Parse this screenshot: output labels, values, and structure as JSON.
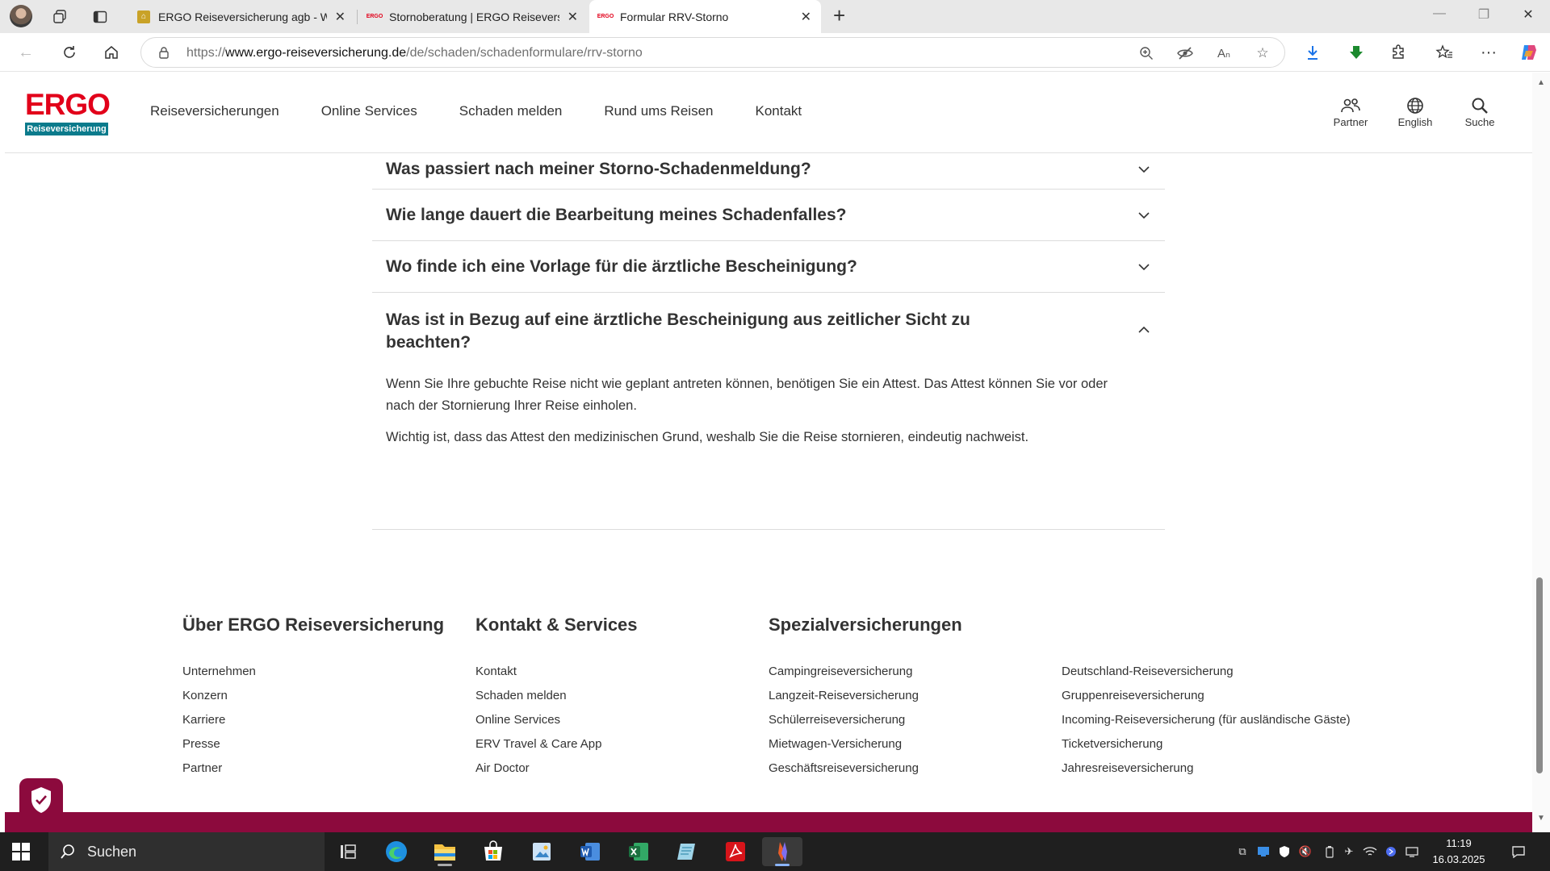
{
  "browser": {
    "tabs": [
      {
        "title": "ERGO Reiseversicherung agb - Wi",
        "favicon": "wikipedia-favicon",
        "active": false
      },
      {
        "title": "Stornoberatung | ERGO Reiseversi",
        "favicon": "ergo-favicon",
        "active": false
      },
      {
        "title": "Formular RRV-Storno",
        "favicon": "ergo-favicon",
        "active": true
      }
    ],
    "favicon_text": "ERGO",
    "url_prefix": "https://",
    "url_domain": "www.ergo-reiseversicherung.de",
    "url_path": "/de/schaden/schadenformulare/rrv-storno"
  },
  "site": {
    "logo_word": "ERGO",
    "logo_sub": "Reiseversicherung",
    "nav": [
      "Reiseversicherungen",
      "Online Services",
      "Schaden melden",
      "Rund ums Reisen",
      "Kontakt"
    ],
    "tools": {
      "partner": "Partner",
      "language": "English",
      "search": "Suche"
    },
    "brand_color": "#e2001a",
    "accent_color": "#8c0a3d"
  },
  "faq": {
    "items": [
      {
        "question": "Was passiert nach meiner Storno-Schadenmeldung?",
        "expanded": false
      },
      {
        "question": "Wie lange dauert die Bearbeitung meines Schadenfalles?",
        "expanded": false
      },
      {
        "question": "Wo finde ich eine Vorlage für die ärztliche Bescheinigung?",
        "expanded": false
      },
      {
        "question": "Was ist in Bezug auf eine ärztliche Bescheinigung aus zeitlicher Sicht zu beachten?",
        "expanded": true,
        "answer": [
          "Wenn Sie Ihre gebuchte Reise nicht wie geplant antreten können, benötigen Sie ein Attest. Das Attest können Sie vor oder nach der Stornierung Ihrer Reise einholen.",
          "Wichtig ist, dass das Attest den medizinischen Grund, weshalb Sie die Reise stornieren, eindeutig nachweist."
        ]
      }
    ]
  },
  "footer": {
    "about": {
      "heading": "Über ERGO Reiseversicherung",
      "links": [
        "Unternehmen",
        "Konzern",
        "Karriere",
        "Presse",
        "Partner"
      ]
    },
    "contact": {
      "heading": "Kontakt & Services",
      "links": [
        "Kontakt",
        "Schaden melden",
        "Online Services",
        "ERV Travel & Care App",
        "Air Doctor"
      ]
    },
    "special": {
      "heading": "Spezialversicherungen",
      "links_col1": [
        "Campingreiseversicherung",
        "Langzeit-Reiseversicherung",
        "Schülerreiseversicherung",
        "Mietwagen-Versicherung",
        "Geschäftsreiseversicherung"
      ],
      "links_col2": [
        "Deutschland-Reiseversicherung",
        "Gruppenreiseversicherung",
        "Incoming-Reiseversicherung (für ausländische Gäste)",
        "Ticketversicherung",
        "Jahresreiseversicherung"
      ]
    }
  },
  "taskbar": {
    "search_label": "Suchen",
    "time": "11:19",
    "date": "16.03.2025"
  }
}
